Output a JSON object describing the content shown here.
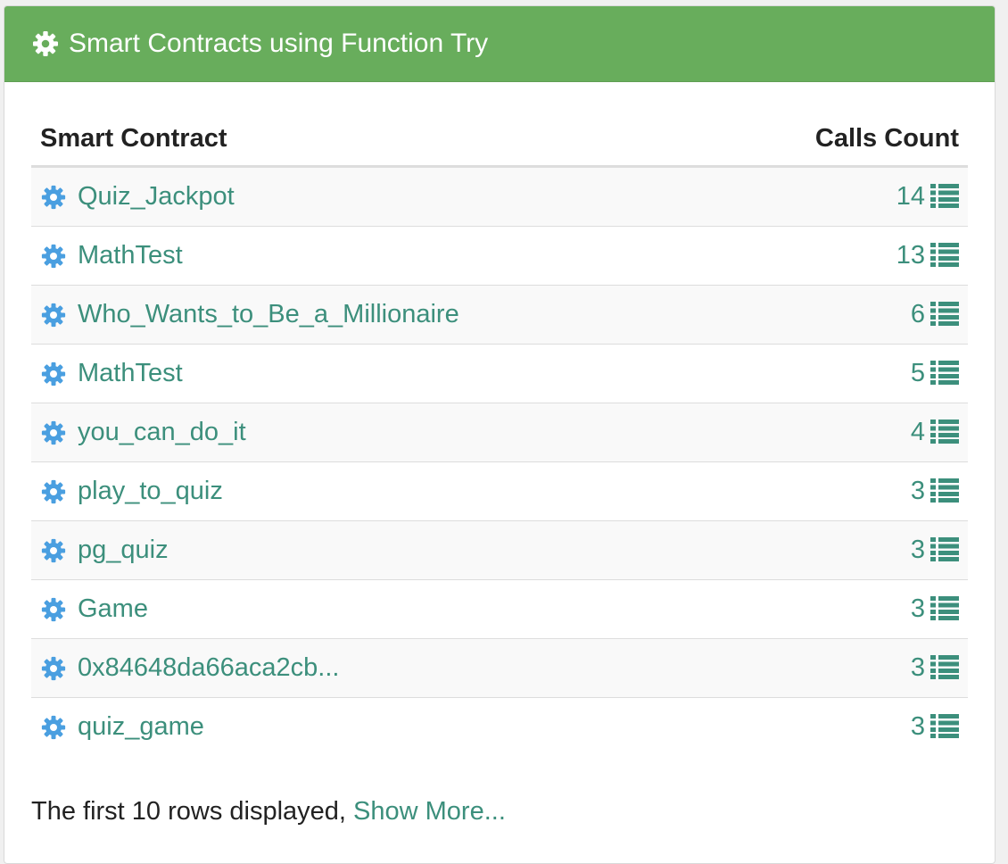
{
  "panel": {
    "title": "Smart Contracts using Function Try",
    "title_icon": "gear-icon"
  },
  "table": {
    "columns": [
      "Smart Contract",
      "Calls Count"
    ],
    "rows": [
      {
        "name": "Quiz_Jackpot",
        "count": "14"
      },
      {
        "name": "MathTest",
        "count": "13"
      },
      {
        "name": "Who_Wants_to_Be_a_Millionaire",
        "count": "6"
      },
      {
        "name": "MathTest",
        "count": "5"
      },
      {
        "name": "you_can_do_it",
        "count": "4"
      },
      {
        "name": "play_to_quiz",
        "count": "3"
      },
      {
        "name": "pg_quiz",
        "count": "3"
      },
      {
        "name": "Game",
        "count": "3"
      },
      {
        "name": "0x84648da66aca2cb...",
        "count": "3"
      },
      {
        "name": "quiz_game",
        "count": "3"
      }
    ]
  },
  "footer": {
    "text": "The first 10 rows displayed, ",
    "link": "Show More..."
  },
  "colors": {
    "header_bg": "#68ad5c",
    "link": "#3c8f7c",
    "gear": "#4a9fe0"
  }
}
